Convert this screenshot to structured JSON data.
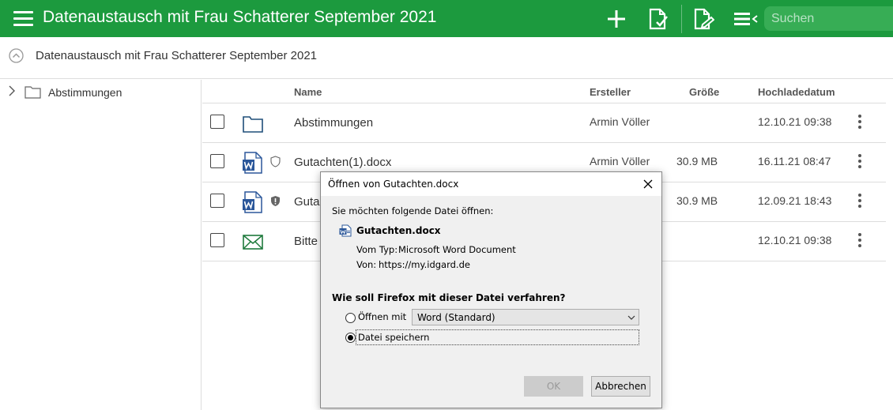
{
  "header": {
    "title": "Datenaustausch mit Frau Schatterer September 2021",
    "search_placeholder": "Suchen",
    "icons": [
      "menu-icon",
      "add-icon",
      "file-check-icon",
      "file-sign-icon",
      "list-menu-icon"
    ],
    "accent_color": "#1c9a3e"
  },
  "breadcrumb": {
    "text": "Datenaustausch mit Frau Schatterer September 2021"
  },
  "tree": {
    "items": [
      {
        "label": "Abstimmungen",
        "icon": "folder-icon"
      }
    ]
  },
  "table": {
    "columns": {
      "name": "Name",
      "creator": "Ersteller",
      "size": "Größe",
      "date": "Hochladedatum"
    },
    "rows": [
      {
        "type": "folder",
        "name": "Abstimmungen",
        "creator": "Armin Völler",
        "size": "",
        "date": "12.10.21 09:38",
        "protection": ""
      },
      {
        "type": "word",
        "name": "Gutachten(1).docx",
        "creator": "Armin Völler",
        "size": "30.9 MB",
        "date": "16.11.21 08:47",
        "protection": "shield-outline"
      },
      {
        "type": "word",
        "name": "Guta",
        "creator": "",
        "size": "30.9 MB",
        "date": "12.09.21 18:43",
        "protection": "shield-filled"
      },
      {
        "type": "mail",
        "name": "Bitte",
        "creator": "",
        "size": "",
        "date": "12.10.21 09:38",
        "protection": ""
      }
    ]
  },
  "dialog": {
    "title": "Öffnen von Gutachten.docx",
    "intro": "Sie möchten folgende Datei öffnen:",
    "filename": "Gutachten.docx",
    "type_label": "Vom Typ:",
    "type_value": "Microsoft Word Document",
    "from_label": "Von:",
    "from_value": "https://my.idgard.de",
    "question": "Wie soll Firefox mit dieser Datei verfahren?",
    "open_with_label": "Öffnen mit",
    "open_with_value": "Word (Standard)",
    "save_label": "Datei speichern",
    "selected_option": "save",
    "ok_label": "OK",
    "cancel_label": "Abbrechen"
  }
}
